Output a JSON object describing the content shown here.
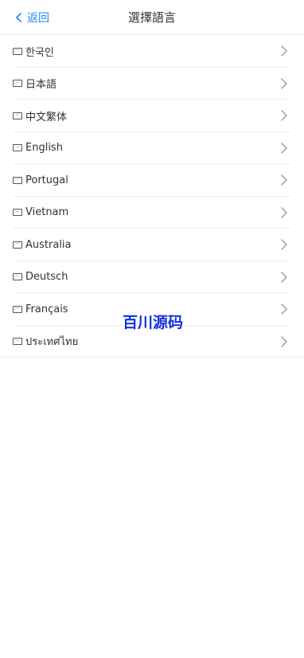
{
  "header": {
    "back_label": "返回",
    "title": "選擇語言",
    "back_icon": "chevron-left-icon"
  },
  "languages": [
    {
      "label": "한국인",
      "icon": "flag-icon"
    },
    {
      "label": "日本語",
      "icon": "flag-icon"
    },
    {
      "label": "中文繁体",
      "icon": "flag-icon"
    },
    {
      "label": "English",
      "icon": "flag-icon"
    },
    {
      "label": "Portugal",
      "icon": "flag-icon"
    },
    {
      "label": "Vietnam",
      "icon": "flag-icon"
    },
    {
      "label": "Australia",
      "icon": "flag-icon"
    },
    {
      "label": "Deutsch",
      "icon": "flag-icon"
    },
    {
      "label": "Français",
      "icon": "flag-icon"
    },
    {
      "label": "ประเทศไทย",
      "icon": "flag-icon"
    }
  ],
  "row_icon": "chevron-right-icon",
  "watermark": "百川源码",
  "colors": {
    "accent": "#1989fa",
    "watermark": "#1530e0",
    "divider": "#ebedf0",
    "text": "#323233"
  }
}
